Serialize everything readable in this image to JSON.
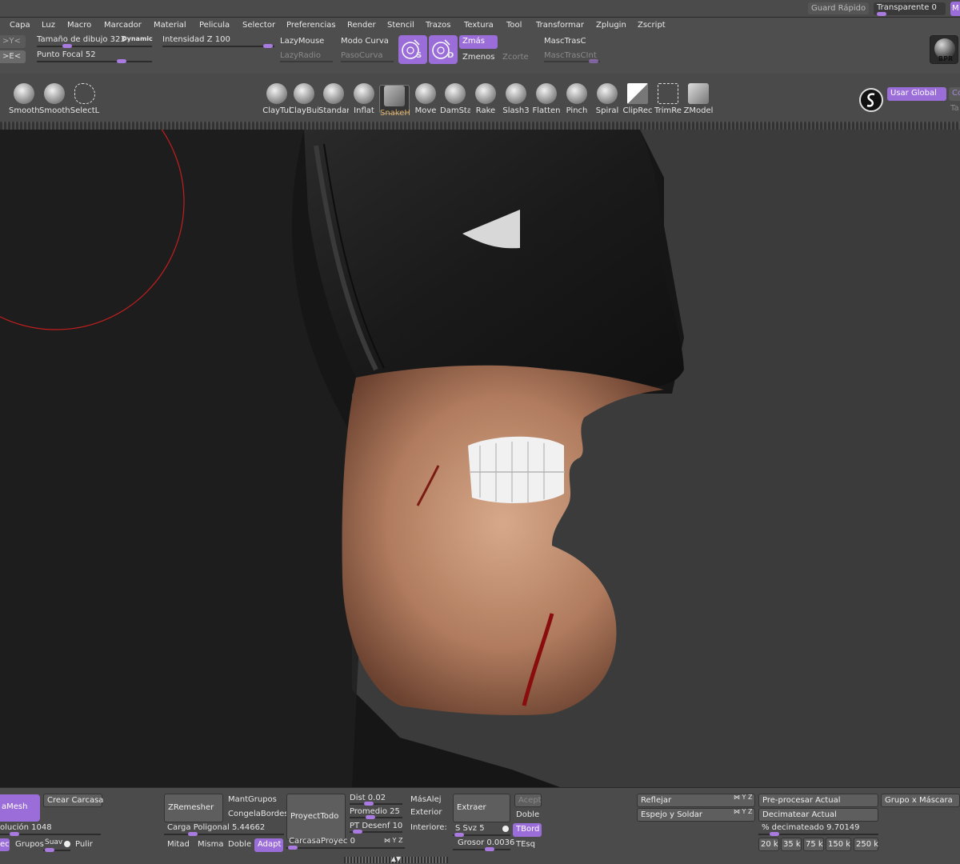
{
  "titlebar": {
    "quicksave": "Guard Rápido",
    "transparent": "Transparente 0",
    "m_cut": "M"
  },
  "menu": [
    "Capa",
    "Luz",
    "Macro",
    "Marcador",
    "Material",
    "Pelicula",
    "Selector",
    "Preferencias",
    "Render",
    "Stencil",
    "Trazos",
    "Textura",
    "Tool",
    "Transformar",
    "Zplugin",
    "Zscript"
  ],
  "toolbar": {
    "sym_y": ">Y<",
    "sym_e": ">E<",
    "draw_size": "Tamaño de dibujo 323",
    "dynamic": "Dynamic",
    "focal": "Punto Focal 52",
    "z_intensity": "Intensidad Z 100",
    "lazymouse": "LazyMouse",
    "lazyradius": "LazyRadio",
    "curve_mode": "Modo Curva",
    "curve_step": "PasoCurva",
    "s_label": "S",
    "d_label": "D",
    "zadd": "Zmás",
    "zsub": "Zmenos",
    "zcut": "Zcorte",
    "masktrasc": "MascTrasC",
    "masktrascint": "MascTrasCInt",
    "bpr": "BPR"
  },
  "brushes": [
    {
      "label": "Smooth"
    },
    {
      "label": "Smooth"
    },
    {
      "label": "SelectL"
    },
    {
      "label": "ClayTul"
    },
    {
      "label": "ClayBui"
    },
    {
      "label": "Standar"
    },
    {
      "label": "Inflat"
    },
    {
      "label": "SnakeH"
    },
    {
      "label": "Move"
    },
    {
      "label": "DamSta"
    },
    {
      "label": "Rake"
    },
    {
      "label": "Slash3"
    },
    {
      "label": "Flatten"
    },
    {
      "label": "Pinch"
    },
    {
      "label": "Spiral"
    },
    {
      "label": "ClipRec"
    },
    {
      "label": "TrimRe"
    },
    {
      "label": "ZModel"
    }
  ],
  "right_tools": {
    "use_global": "Usar Global",
    "co_cut": "Co",
    "ta_cut": "Ta"
  },
  "bottom": {
    "mesh": "aMesh",
    "make_shell": "Crear Carcasa",
    "resolution": "olución 1048",
    "polygroups": "Grupos",
    "smooth": "Suav",
    "polish": "Pulir",
    "ec": "ec",
    "zremesher": "ZRemesher",
    "keep_groups": "MantGrupos",
    "freeze_borders": "CongelaBordes",
    "poly_load": "Carga Poligonal 5.44662",
    "half": "Mitad",
    "same": "Misma",
    "double": "Doble",
    "adapt": "Adapt",
    "project_all": "ProyectTodo",
    "shell_proj": "CarcasaProyec 0",
    "dist": "Dist 0.02",
    "mean": "Promedio 25",
    "pt_blur": "PT Desenf 10",
    "farther": "MásAlej",
    "outer": "Exterior",
    "inner": "Interiore:",
    "extract": "Extraer",
    "accept": "Acept",
    "double2": "Doble",
    "s_smt": "S Svz 5",
    "tbord": "TBord",
    "thick": "Grosor 0.0036",
    "tesq": "TEsq",
    "mirror": "Reflejar",
    "mirror_weld": "Espejo y Soldar",
    "preprocess": "Pre-procesar Actual",
    "decimate": "Decimatear Actual",
    "pct": "% decimateado 9.70149",
    "groups_mask": "Grupo x Máscara",
    "k": [
      "20 k",
      "35 k",
      "75 k",
      "150 k",
      "250 k"
    ]
  },
  "colors": {
    "accent": "#9b6dd9",
    "panel": "#4e4e4e",
    "viewport": "#3a3a3a"
  }
}
